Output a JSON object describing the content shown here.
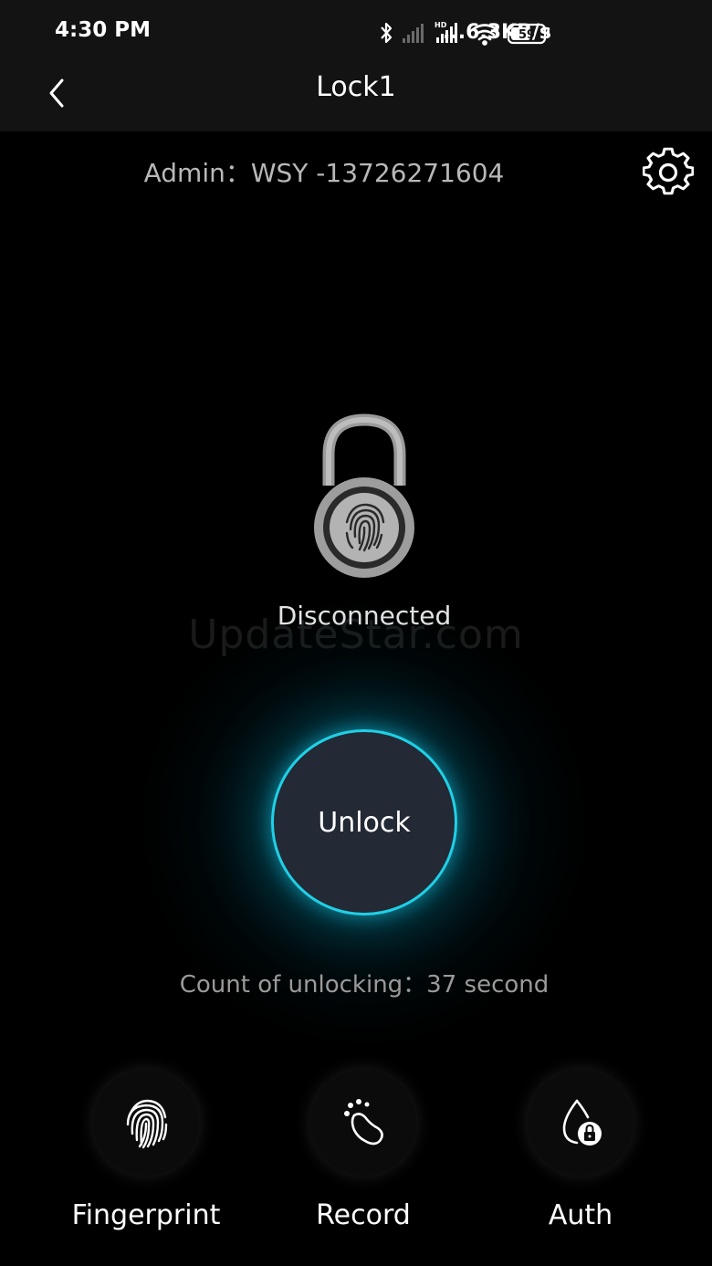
{
  "status_bar": {
    "time": "4:30 PM",
    "network_speed": "...6.3KB/s",
    "battery_level": "59",
    "icons": [
      "bluetooth-icon",
      "signal-icon",
      "hd-signal-icon",
      "wifi-icon",
      "battery-icon"
    ]
  },
  "nav": {
    "title": "Lock1",
    "back_icon": "chevron-left-icon"
  },
  "admin": {
    "text": "Admin：WSY -13726271604",
    "settings_icon": "gear-icon"
  },
  "lock": {
    "icon": "padlock-fingerprint-icon",
    "status": "Disconnected"
  },
  "watermark": "UpdateStar.com",
  "unlock": {
    "label": "Unlock",
    "count_text": "Count of unlocking：37 second"
  },
  "actions": [
    {
      "label": "Fingerprint",
      "icon": "fingerprint-icon"
    },
    {
      "label": "Record",
      "icon": "record-icon"
    },
    {
      "label": "Auth",
      "icon": "auth-lock-icon"
    }
  ],
  "colors": {
    "background": "#000000",
    "bar": "#131313",
    "accent": "#1fd0e6",
    "unlock_fill": "#232935",
    "muted_text": "#9a9a9a"
  }
}
